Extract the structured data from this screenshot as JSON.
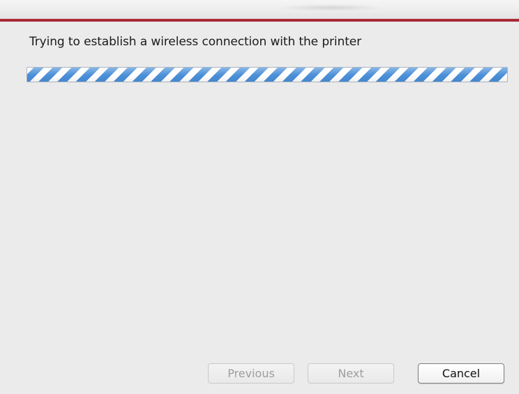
{
  "dialog": {
    "status_message": "Trying to establish a wireless connection with the printer",
    "progress": {
      "state": "indeterminate",
      "style": "barber-pole",
      "stripe_color": "#4a8fd8",
      "fill_fraction": 1.0
    }
  },
  "buttons": {
    "previous": {
      "label": "Previous",
      "enabled": false
    },
    "next": {
      "label": "Next",
      "enabled": false
    },
    "cancel": {
      "label": "Cancel",
      "enabled": true
    }
  },
  "colors": {
    "accent": "#b52f3a",
    "background": "#ebebeb"
  }
}
